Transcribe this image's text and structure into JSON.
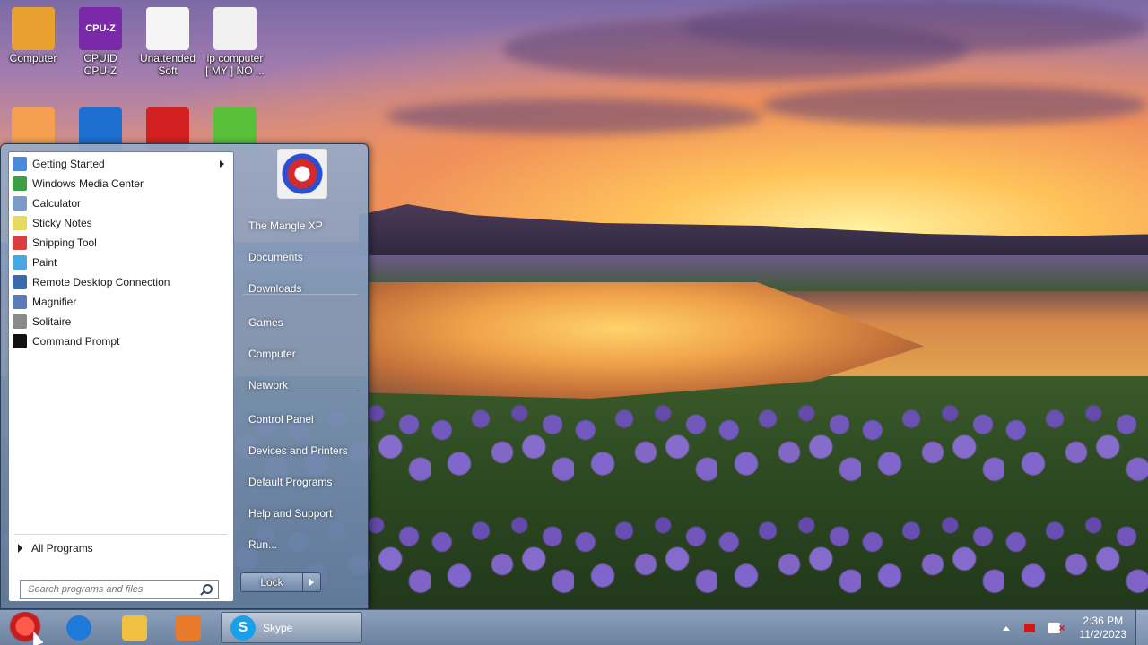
{
  "desktop": {
    "icons": [
      {
        "label": "Computer",
        "icon": "computer-icon",
        "color": "#e8a030"
      },
      {
        "label": "CPUID CPU-Z",
        "line1": "CPUID",
        "line2": "CPU-Z",
        "icon": "cpu-z-icon",
        "color": "#7a2aa8",
        "badge": "CPU-Z"
      },
      {
        "label": "Unattended Soft",
        "line1": "Unattended",
        "line2": "Soft",
        "icon": "blank-document-icon",
        "color": "#f5f5f5"
      },
      {
        "label": "ip computer [ MY ] NO ...",
        "line1": "ip computer",
        "line2": "[ MY ] NO ...",
        "icon": "text-document-icon",
        "color": "#f0f0f0"
      },
      {
        "label": "",
        "icon": "egg-icon",
        "color": "#f4a050"
      },
      {
        "label": "",
        "icon": "blue-moon-icon",
        "color": "#1e6fd0"
      },
      {
        "label": "",
        "icon": "shield-icon",
        "color": "#d42020"
      },
      {
        "label": "",
        "icon": "usb-check-icon",
        "color": "#5ac03a"
      }
    ]
  },
  "start_menu": {
    "programs": [
      {
        "label": "Getting Started",
        "icon": "getting-started-icon",
        "color": "#4a8ad8",
        "submenu": true
      },
      {
        "label": "Windows Media Center",
        "icon": "media-center-icon",
        "color": "#3aa040"
      },
      {
        "label": "Calculator",
        "icon": "calculator-icon",
        "color": "#7a9ac8"
      },
      {
        "label": "Sticky Notes",
        "icon": "sticky-notes-icon",
        "color": "#e8d860"
      },
      {
        "label": "Snipping Tool",
        "icon": "snipping-tool-icon",
        "color": "#d84040"
      },
      {
        "label": "Paint",
        "icon": "paint-icon",
        "color": "#4aa8e0"
      },
      {
        "label": "Remote Desktop Connection",
        "icon": "remote-desktop-icon",
        "color": "#3a6ab0"
      },
      {
        "label": "Magnifier",
        "icon": "magnifier-icon",
        "color": "#5a7ab8"
      },
      {
        "label": "Solitaire",
        "icon": "solitaire-icon",
        "color": "#8a8a8a"
      },
      {
        "label": "Command Prompt",
        "icon": "command-prompt-icon",
        "color": "#111111"
      }
    ],
    "all_programs": "All Programs",
    "search_placeholder": "Search programs and files",
    "right_items": [
      {
        "label": "The Mangle XP",
        "name": "right-item-user"
      },
      {
        "label": "Documents",
        "name": "right-item-documents"
      },
      {
        "label": "Downloads",
        "name": "right-item-downloads"
      },
      {
        "label": "Games",
        "name": "right-item-games"
      },
      {
        "label": "Computer",
        "name": "right-item-computer"
      },
      {
        "label": "Network",
        "name": "right-item-network"
      },
      {
        "label": "Control Panel",
        "name": "right-item-control-panel"
      },
      {
        "label": "Devices and Printers",
        "name": "right-item-devices-printers"
      },
      {
        "label": "Default Programs",
        "name": "right-item-default-programs"
      },
      {
        "label": "Help and Support",
        "name": "right-item-help-support"
      },
      {
        "label": "Run...",
        "name": "right-item-run"
      }
    ],
    "lock_label": "Lock"
  },
  "taskbar": {
    "pinned": [
      {
        "icon": "internet-explorer-icon",
        "color": "#1e7ad8"
      },
      {
        "icon": "folder-icon",
        "color": "#f0c040"
      },
      {
        "icon": "media-player-icon",
        "color": "#e87a2a"
      }
    ],
    "active_window": "Skype",
    "clock_time": "2:36 PM",
    "clock_date": "11/2/2023"
  }
}
